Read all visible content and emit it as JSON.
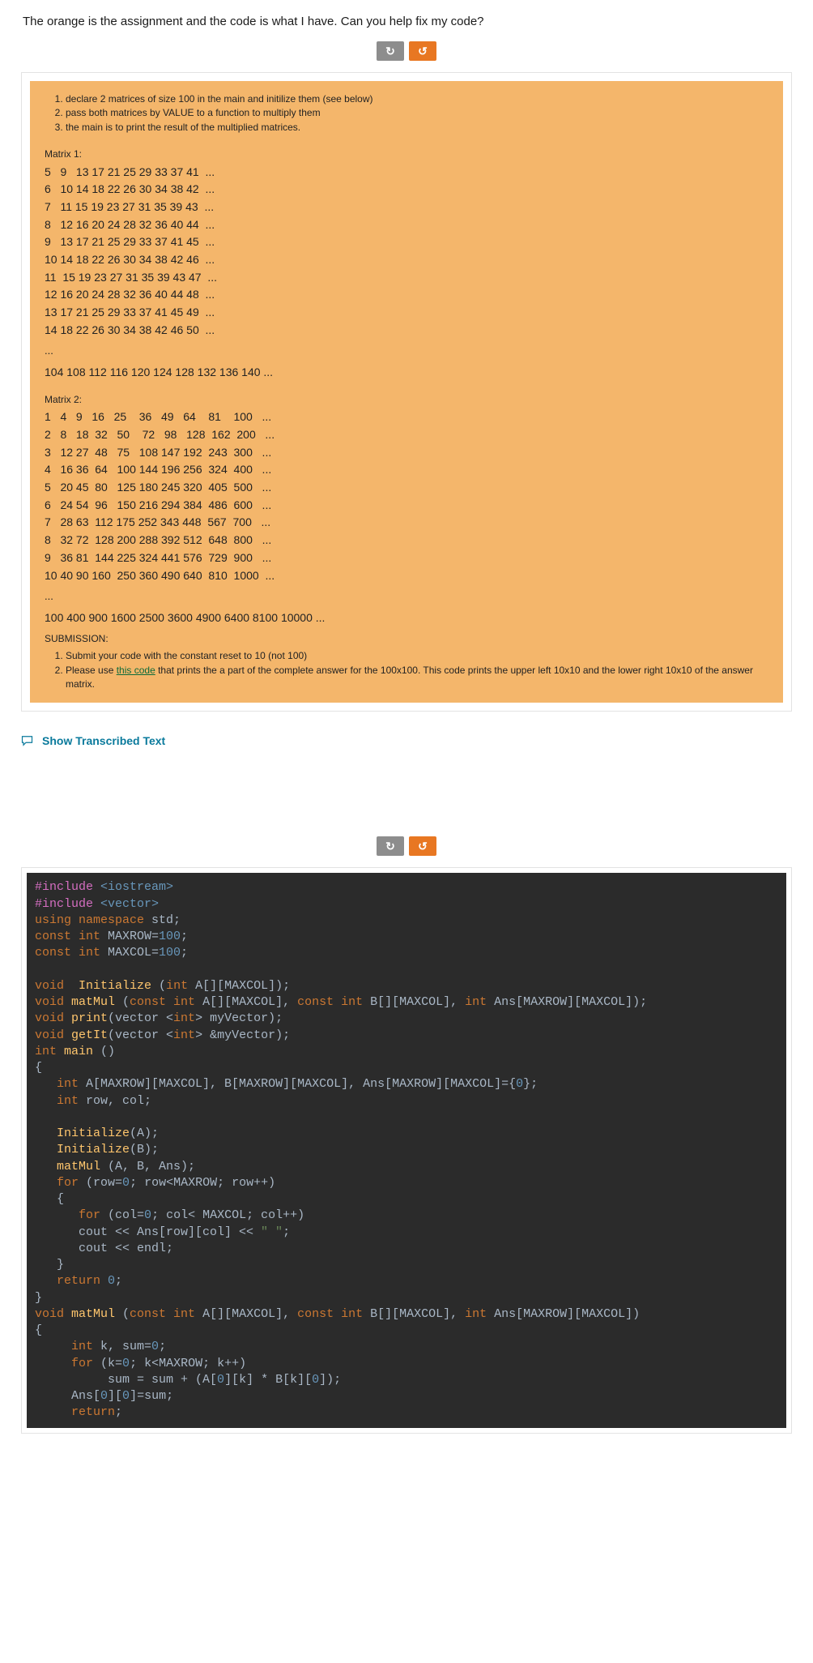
{
  "question": "The orange is the assignment and the code is what I have. Can you help fix my code?",
  "toolbar": {
    "refresh": "↻",
    "redo": "↺"
  },
  "assignment": {
    "steps": [
      "declare 2 matrices of size 100 in the main and initilize them (see below)",
      "pass both matrices by VALUE to a function to multiply them",
      "the main is to print the result of the multiplied matrices."
    ],
    "m1_label": "Matrix 1:",
    "m1_rows": [
      "5   9   13 17 21 25 29 33 37 41  ...",
      "6   10 14 18 22 26 30 34 38 42  ...",
      "7   11 15 19 23 27 31 35 39 43  ...",
      "8   12 16 20 24 28 32 36 40 44  ...",
      "9   13 17 21 25 29 33 37 41 45  ...",
      "10 14 18 22 26 30 34 38 42 46  ...",
      "11  15 19 23 27 31 35 39 43 47  ...",
      "12 16 20 24 28 32 36 40 44 48  ...",
      "13 17 21 25 29 33 37 41 45 49  ...",
      "14 18 22 26 30 34 38 42 46 50  ..."
    ],
    "m1_ell": "...",
    "m1_last": "104 108 112 116 120 124 128 132 136 140 ...",
    "m2_label": "Matrix 2:",
    "m2_rows": [
      "1   4   9   16   25    36   49   64    81    100   ...",
      "2   8   18  32   50    72   98   128  162  200   ...",
      "3   12 27  48   75   108 147 192  243  300   ...",
      "4   16 36  64   100 144 196 256  324  400   ...",
      "5   20 45  80   125 180 245 320  405  500   ...",
      "6   24 54  96   150 216 294 384  486  600   ...",
      "7   28 63  112 175 252 343 448  567  700   ...",
      "8   32 72  128 200 288 392 512  648  800   ...",
      "9   36 81  144 225 324 441 576  729  900   ...",
      "10 40 90 160  250 360 490 640  810  1000  ..."
    ],
    "m2_ell": "...",
    "m2_last": "100 400 900 1600 2500 3600 4900 6400 8100 10000 ...",
    "submission_head": "SUBMISSION:",
    "submission_items": [
      "Submit your code with the constant reset to 10 (not 100)",
      "Please use "
    ],
    "submission_link": "this code",
    "submission_tail": " that prints the a part of the complete answer for the 100x100. This code prints the upper left 10x10 and the lower right 10x10 of the answer matrix."
  },
  "transcribe_label": "Show Transcribed Text",
  "code": {
    "lines": [
      {
        "t": "pp",
        "s": "#include "
      },
      {
        "t": "lib",
        "s": "<iostream>"
      },
      {
        "nl": 1
      },
      {
        "t": "pp",
        "s": "#include "
      },
      {
        "t": "lib",
        "s": "<vector>"
      },
      {
        "nl": 1
      },
      {
        "t": "kw",
        "s": "using namespace "
      },
      {
        "t": "id",
        "s": "std;"
      },
      {
        "nl": 1
      },
      {
        "t": "kw",
        "s": "const int "
      },
      {
        "t": "id",
        "s": "MAXROW="
      },
      {
        "t": "num",
        "s": "100"
      },
      {
        "t": "id",
        "s": ";"
      },
      {
        "nl": 1
      },
      {
        "t": "kw",
        "s": "const int "
      },
      {
        "t": "id",
        "s": "MAXCOL="
      },
      {
        "t": "num",
        "s": "100"
      },
      {
        "t": "id",
        "s": ";"
      },
      {
        "nl": 1
      },
      {
        "nl": 1
      },
      {
        "t": "void",
        "s": "void  "
      },
      {
        "t": "fn",
        "s": "Initialize "
      },
      {
        "t": "id",
        "s": "("
      },
      {
        "t": "kw",
        "s": "int "
      },
      {
        "t": "id",
        "s": "A[][MAXCOL]);"
      },
      {
        "nl": 1
      },
      {
        "t": "void",
        "s": "void "
      },
      {
        "t": "fn",
        "s": "matMul "
      },
      {
        "t": "id",
        "s": "("
      },
      {
        "t": "kw",
        "s": "const int "
      },
      {
        "t": "id",
        "s": "A[][MAXCOL], "
      },
      {
        "t": "kw",
        "s": "const int "
      },
      {
        "t": "id",
        "s": "B[][MAXCOL], "
      },
      {
        "t": "kw",
        "s": "int "
      },
      {
        "t": "id",
        "s": "Ans[MAXROW][MAXCOL]);"
      },
      {
        "nl": 1
      },
      {
        "t": "void",
        "s": "void "
      },
      {
        "t": "fn",
        "s": "print"
      },
      {
        "t": "id",
        "s": "(vector <"
      },
      {
        "t": "kw",
        "s": "int"
      },
      {
        "t": "id",
        "s": "> myVector);"
      },
      {
        "nl": 1
      },
      {
        "t": "void",
        "s": "void "
      },
      {
        "t": "fn",
        "s": "getIt"
      },
      {
        "t": "id",
        "s": "(vector <"
      },
      {
        "t": "kw",
        "s": "int"
      },
      {
        "t": "id",
        "s": "> &myVector);"
      },
      {
        "nl": 1
      },
      {
        "t": "kw",
        "s": "int "
      },
      {
        "t": "fn",
        "s": "main "
      },
      {
        "t": "id",
        "s": "()"
      },
      {
        "nl": 1
      },
      {
        "t": "id",
        "s": "{"
      },
      {
        "nl": 1
      },
      {
        "t": "id",
        "s": "   "
      },
      {
        "t": "kw",
        "s": "int "
      },
      {
        "t": "id",
        "s": "A[MAXROW][MAXCOL], B[MAXROW][MAXCOL], Ans[MAXROW][MAXCOL]={"
      },
      {
        "t": "num",
        "s": "0"
      },
      {
        "t": "id",
        "s": "};"
      },
      {
        "nl": 1
      },
      {
        "t": "id",
        "s": "   "
      },
      {
        "t": "kw",
        "s": "int "
      },
      {
        "t": "id",
        "s": "row, col;"
      },
      {
        "nl": 1
      },
      {
        "nl": 1
      },
      {
        "t": "id",
        "s": "   "
      },
      {
        "t": "fn",
        "s": "Initialize"
      },
      {
        "t": "id",
        "s": "(A);"
      },
      {
        "nl": 1
      },
      {
        "t": "id",
        "s": "   "
      },
      {
        "t": "fn",
        "s": "Initialize"
      },
      {
        "t": "id",
        "s": "(B);"
      },
      {
        "nl": 1
      },
      {
        "t": "id",
        "s": "   "
      },
      {
        "t": "fn",
        "s": "matMul "
      },
      {
        "t": "id",
        "s": "(A, B, Ans);"
      },
      {
        "nl": 1
      },
      {
        "t": "id",
        "s": "   "
      },
      {
        "t": "kw",
        "s": "for "
      },
      {
        "t": "id",
        "s": "(row="
      },
      {
        "t": "num",
        "s": "0"
      },
      {
        "t": "id",
        "s": "; row<MAXROW; row++)"
      },
      {
        "nl": 1
      },
      {
        "t": "id",
        "s": "   {"
      },
      {
        "nl": 1
      },
      {
        "t": "id",
        "s": "      "
      },
      {
        "t": "kw",
        "s": "for "
      },
      {
        "t": "id",
        "s": "(col="
      },
      {
        "t": "num",
        "s": "0"
      },
      {
        "t": "id",
        "s": "; col< MAXCOL; col++)"
      },
      {
        "nl": 1
      },
      {
        "t": "id",
        "s": "      cout << Ans[row][col] << "
      },
      {
        "t": "str",
        "s": "\" \""
      },
      {
        "t": "id",
        "s": ";"
      },
      {
        "nl": 1
      },
      {
        "t": "id",
        "s": "      cout << endl;"
      },
      {
        "nl": 1
      },
      {
        "t": "id",
        "s": "   }"
      },
      {
        "nl": 1
      },
      {
        "t": "id",
        "s": "   "
      },
      {
        "t": "kw",
        "s": "return "
      },
      {
        "t": "num",
        "s": "0"
      },
      {
        "t": "id",
        "s": ";"
      },
      {
        "nl": 1
      },
      {
        "t": "id",
        "s": "}"
      },
      {
        "nl": 1
      },
      {
        "t": "void",
        "s": "void "
      },
      {
        "t": "fn",
        "s": "matMul "
      },
      {
        "t": "id",
        "s": "("
      },
      {
        "t": "kw",
        "s": "const int "
      },
      {
        "t": "id",
        "s": "A[][MAXCOL], "
      },
      {
        "t": "kw",
        "s": "const int "
      },
      {
        "t": "id",
        "s": "B[][MAXCOL], "
      },
      {
        "t": "kw",
        "s": "int "
      },
      {
        "t": "id",
        "s": "Ans[MAXROW][MAXCOL])"
      },
      {
        "nl": 1
      },
      {
        "t": "id",
        "s": "{"
      },
      {
        "nl": 1
      },
      {
        "t": "id",
        "s": "     "
      },
      {
        "t": "kw",
        "s": "int "
      },
      {
        "t": "id",
        "s": "k, sum="
      },
      {
        "t": "num",
        "s": "0"
      },
      {
        "t": "id",
        "s": ";"
      },
      {
        "nl": 1
      },
      {
        "t": "id",
        "s": "     "
      },
      {
        "t": "kw",
        "s": "for "
      },
      {
        "t": "id",
        "s": "(k="
      },
      {
        "t": "num",
        "s": "0"
      },
      {
        "t": "id",
        "s": "; k<MAXROW; k++)"
      },
      {
        "nl": 1
      },
      {
        "t": "id",
        "s": "          sum = sum + (A["
      },
      {
        "t": "num",
        "s": "0"
      },
      {
        "t": "id",
        "s": "][k] * B[k]["
      },
      {
        "t": "num",
        "s": "0"
      },
      {
        "t": "id",
        "s": "]);"
      },
      {
        "nl": 1
      },
      {
        "t": "id",
        "s": "     Ans["
      },
      {
        "t": "num",
        "s": "0"
      },
      {
        "t": "id",
        "s": "]["
      },
      {
        "t": "num",
        "s": "0"
      },
      {
        "t": "id",
        "s": "]=sum;"
      },
      {
        "nl": 1
      },
      {
        "t": "id",
        "s": "     "
      },
      {
        "t": "kw",
        "s": "return"
      },
      {
        "t": "id",
        "s": ";"
      },
      {
        "nl": 1
      }
    ]
  }
}
